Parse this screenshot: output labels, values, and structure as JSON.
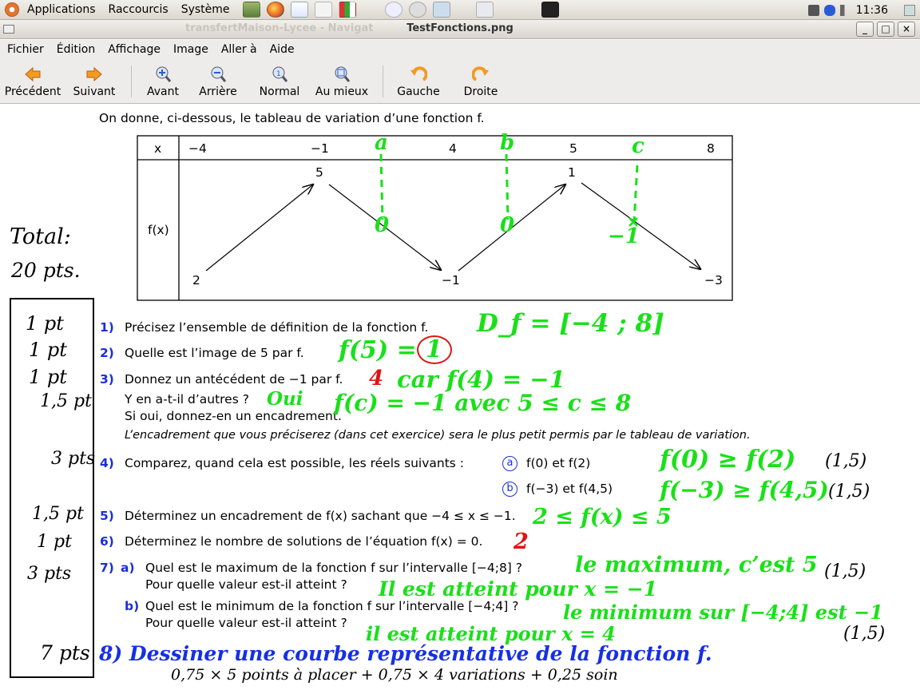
{
  "panel": {
    "menus": [
      "Applications",
      "Raccourcis",
      "Système"
    ],
    "clock": "11:36"
  },
  "window": {
    "background_title": "transfertMaison-Lycee - Navigat",
    "title": "TestFonctions.png",
    "buttons": [
      "_",
      "□",
      "×"
    ]
  },
  "menubar": [
    "Fichier",
    "Édition",
    "Affichage",
    "Image",
    "Aller à",
    "Aide"
  ],
  "toolbar": [
    {
      "label": "Précédent",
      "icon": "arrow-left-icon"
    },
    {
      "label": "Suivant",
      "icon": "arrow-right-icon"
    },
    {
      "label": "Avant",
      "icon": "zoom-in-icon"
    },
    {
      "label": "Arrière",
      "icon": "zoom-out-icon"
    },
    {
      "label": "Normal",
      "icon": "zoom-normal-icon"
    },
    {
      "label": "Au mieux",
      "icon": "zoom-fit-icon"
    },
    {
      "label": "Gauche",
      "icon": "rotate-left-icon"
    },
    {
      "label": "Droite",
      "icon": "rotate-right-icon"
    }
  ],
  "document": {
    "intro": "On donne, ci-dessous, le tableau de variation d’une fonction f.",
    "table": {
      "x_label": "x",
      "fx_label": "f(x)",
      "x_values": [
        "−4",
        "−1",
        "4",
        "5",
        "8"
      ],
      "f_values": [
        "2",
        "5",
        "−1",
        "1",
        "−3"
      ]
    },
    "questions": {
      "q1_num": "1)",
      "q1": "Précisez l’ensemble de définition de la fonction f.",
      "q2_num": "2)",
      "q2": "Quelle est l’image de 5 par f.",
      "q3_num": "3)",
      "q3": "Donnez un antécédent de −1 par f.",
      "q3b": "Y en a-t-il d’autres ?",
      "q3c": "Si oui, donnez-en un encadrement.",
      "q3_note": "L’encadrement que vous préciserez (dans cet exercice) sera le plus petit permis par le tableau de variation.",
      "q4_num": "4)",
      "q4": "Comparez, quand cela est possible, les réels suivants :",
      "q4a_mark": "a",
      "q4a": "f(0)  et f(2)",
      "q4b_mark": "b",
      "q4b": "f(−3)  et f(4,5)",
      "q5_num": "5)",
      "q5": "Déterminez un encadrement de f(x) sachant que −4 ≤ x ≤ −1.",
      "q6_num": "6)",
      "q6": "Déterminez le nombre de solutions de l’équation f(x) = 0.",
      "q7_num": "7)",
      "q7a_mark": "a)",
      "q7a": "Quel est le maximum de la fonction f sur l’intervalle [−4;8] ?",
      "q7a2": "Pour quelle valeur est-il atteint ?",
      "q7b_mark": "b)",
      "q7b": "Quel est le minimum de la fonction f sur l’intervalle [−4;4] ?",
      "q7b2": "Pour quelle valeur est-il atteint ?"
    }
  },
  "annotations": {
    "total": "Total:",
    "total_pts": "20 pts.",
    "scores": [
      "1 pt",
      "1 pt",
      "1 pt",
      "1,5 pt",
      "3 pts",
      "1,5 pt",
      "1 pt",
      "3 pts",
      "7 pts"
    ],
    "table_a": "a",
    "table_b": "b",
    "table_c": "c",
    "zero1": "0",
    "zero2": "0",
    "minus1": "−1",
    "a1": "D_f = [−4 ; 8]",
    "a2_fx": "f(5) =",
    "a2_val": "1",
    "a3_red": "4",
    "a3": "car f(4) = −1",
    "a3b_oui": "Oui",
    "a3b": "f(c) = −1   avec   5 ≤ c ≤ 8",
    "a4a": "f(0) ≥ f(2)",
    "a4b": "f(−3) ≥ f(4,5)",
    "a4a_pts": "(1,5)",
    "a4b_pts": "(1,5)",
    "a5": "2 ≤ f(x) ≤ 5",
    "a6": "2",
    "a7a": "le maximum, c’est 5",
    "a7a_pts": "(1,5)",
    "a7a2": "Il est atteint pour  x = −1",
    "a7b": "le minimum sur [−4;4] est −1",
    "a7b_pts": "(1,5)",
    "a7b2": "il est atteint pour  x = 4",
    "q8": "8)  Dessiner une courbe représentative de la fonction f.",
    "q8_note": "0,75 × 5 points à placer  + 0,75 × 4 variations  + 0,25 soin"
  }
}
